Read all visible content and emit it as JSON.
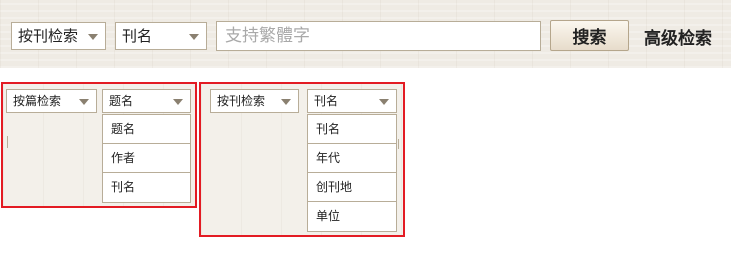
{
  "toolbar": {
    "scope_select": "按刊检索",
    "field_select": "刊名",
    "search_placeholder": "支持繁體字",
    "search_button": "搜索",
    "advanced_search": "高级检索"
  },
  "left_example": {
    "scope_select": "按篇检索",
    "field_select": "题名",
    "options": [
      "题名",
      "作者",
      "刊名"
    ]
  },
  "right_example": {
    "scope_select": "按刊检索",
    "field_select": "刊名",
    "options": [
      "刊名",
      "年代",
      "创刊地",
      "单位"
    ]
  },
  "colors": {
    "highlight_frame": "#e31b23",
    "toolbar_bg": "#efebe4"
  },
  "icons": [
    "dropdown-arrow-icon"
  ]
}
